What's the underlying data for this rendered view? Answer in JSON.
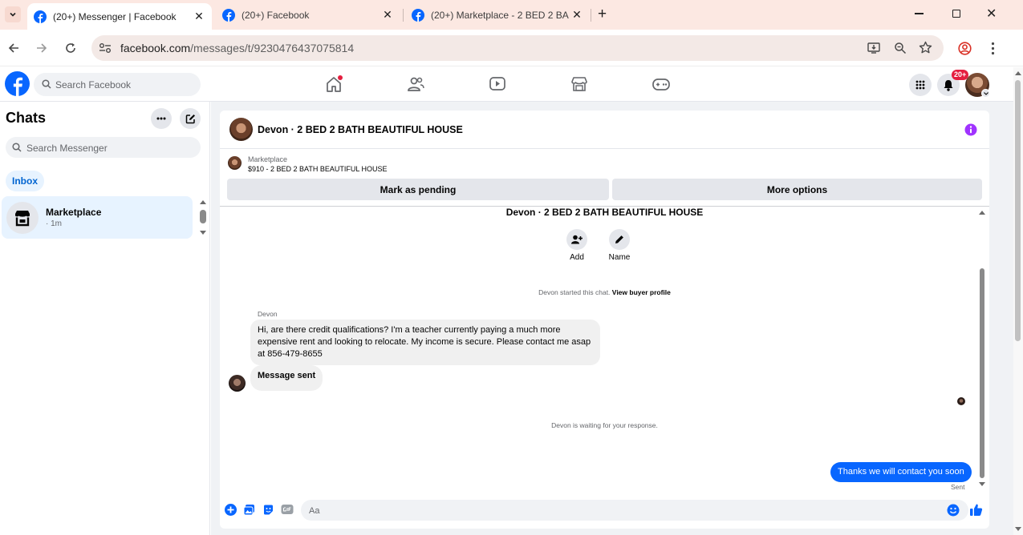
{
  "browser": {
    "tabs": [
      {
        "title": "(20+) Messenger | Facebook",
        "active": true
      },
      {
        "title": "(20+) Facebook",
        "active": false
      },
      {
        "title": "(20+) Marketplace - 2 BED 2 BA",
        "active": false
      }
    ],
    "url_host": "facebook.com",
    "url_path": "/messages/t/9230476437075814"
  },
  "fb": {
    "search_placeholder": "Search Facebook",
    "notif_badge": "20+",
    "brand_color": "#0866ff"
  },
  "sidebar": {
    "title": "Chats",
    "search_placeholder": "Search Messenger",
    "filter": "Inbox",
    "chats": [
      {
        "name": "Marketplace",
        "time": "· 1m"
      }
    ]
  },
  "conversation": {
    "header_title": "Devon · 2 BED 2 BATH BEAUTIFUL HOUSE",
    "listing_source": "Marketplace",
    "listing_summary": "$910 - 2 BED 2 BATH BEAUTIFUL HOUSE",
    "mark_pending": "Mark as pending",
    "more_options": "More options",
    "thread_title": "Devon · 2 BED 2 BATH BEAUTIFUL HOUSE",
    "add_label": "Add",
    "name_label": "Name",
    "started_text": "Devon started this chat.",
    "view_profile": "View buyer profile",
    "sender_name": "Devon",
    "incoming_message": "Hi, are there credit qualifications? I'm a teacher currently paying a much more expensive rent and looking to relocate. My income is secure. Please contact me asap at 856-479-8655",
    "message_sent": "Message sent",
    "waiting_text": "Devon is waiting for your response.",
    "outgoing_message": "Thanks we will contact you soon",
    "status": "Sent",
    "composer_placeholder": "Aa"
  }
}
